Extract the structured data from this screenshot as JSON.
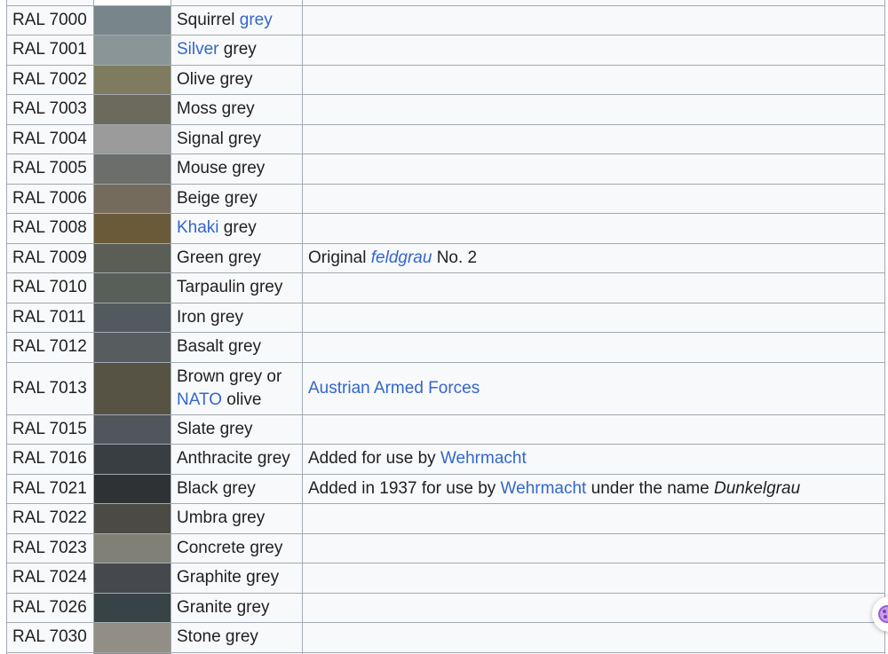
{
  "rows": [
    {
      "code": "",
      "color": "#ffffff",
      "name": [],
      "note": []
    },
    {
      "code": "RAL 7000",
      "color": "#78858b",
      "name": [
        {
          "t": "Squirrel "
        },
        {
          "t": "grey",
          "link": true
        }
      ],
      "note": []
    },
    {
      "code": "RAL 7001",
      "color": "#8a9597",
      "name": [
        {
          "t": "Silver",
          "link": true
        },
        {
          "t": " grey"
        }
      ],
      "note": []
    },
    {
      "code": "RAL 7002",
      "color": "#7e7b5f",
      "name": [
        {
          "t": "Olive grey"
        }
      ],
      "note": []
    },
    {
      "code": "RAL 7003",
      "color": "#6c6a5d",
      "name": [
        {
          "t": "Moss grey"
        }
      ],
      "note": []
    },
    {
      "code": "RAL 7004",
      "color": "#9b9b9b",
      "name": [
        {
          "t": "Signal grey"
        }
      ],
      "note": []
    },
    {
      "code": "RAL 7005",
      "color": "#6c6e6b",
      "name": [
        {
          "t": "Mouse grey"
        }
      ],
      "note": []
    },
    {
      "code": "RAL 7006",
      "color": "#756b5d",
      "name": [
        {
          "t": "Beige grey"
        }
      ],
      "note": []
    },
    {
      "code": "RAL 7008",
      "color": "#6a5a3a",
      "name": [
        {
          "t": "Khaki",
          "link": true
        },
        {
          "t": " grey"
        }
      ],
      "note": []
    },
    {
      "code": "RAL 7009",
      "color": "#5a5e54",
      "name": [
        {
          "t": "Green grey"
        }
      ],
      "note": [
        {
          "t": "Original "
        },
        {
          "t": "feldgrau",
          "link": true,
          "italic": true
        },
        {
          "t": " No. 2"
        }
      ]
    },
    {
      "code": "RAL 7010",
      "color": "#585e58",
      "name": [
        {
          "t": "Tarpaulin grey"
        }
      ],
      "note": []
    },
    {
      "code": "RAL 7011",
      "color": "#535a5f",
      "name": [
        {
          "t": "Iron grey"
        }
      ],
      "note": []
    },
    {
      "code": "RAL 7012",
      "color": "#575d5e",
      "name": [
        {
          "t": "Basalt grey"
        }
      ],
      "note": []
    },
    {
      "code": "RAL 7013",
      "color": "#565344",
      "tall": true,
      "name": [
        {
          "t": "Brown grey or "
        },
        {
          "t": "NATO",
          "link": true
        },
        {
          "t": " olive"
        }
      ],
      "note": [
        {
          "t": "Austrian Armed Forces",
          "link": true
        }
      ]
    },
    {
      "code": "RAL 7015",
      "color": "#51565c",
      "name": [
        {
          "t": "Slate grey"
        }
      ],
      "note": []
    },
    {
      "code": "RAL 7016",
      "color": "#383e42",
      "name": [
        {
          "t": "Anthracite grey"
        }
      ],
      "note": [
        {
          "t": "Added for use by "
        },
        {
          "t": "Wehrmacht",
          "link": true
        }
      ]
    },
    {
      "code": "RAL 7021",
      "color": "#2f3234",
      "name": [
        {
          "t": "Black grey"
        }
      ],
      "note": [
        {
          "t": "Added in 1937 for use by "
        },
        {
          "t": "Wehrmacht",
          "link": true
        },
        {
          "t": " under the name "
        },
        {
          "t": "Dunkelgrau",
          "italic": true
        }
      ]
    },
    {
      "code": "RAL 7022",
      "color": "#4c4a44",
      "name": [
        {
          "t": "Umbra grey"
        }
      ],
      "note": []
    },
    {
      "code": "RAL 7023",
      "color": "#808076",
      "name": [
        {
          "t": "Concrete grey"
        }
      ],
      "note": []
    },
    {
      "code": "RAL 7024",
      "color": "#45494e",
      "name": [
        {
          "t": "Graphite grey"
        }
      ],
      "note": []
    },
    {
      "code": "RAL 7026",
      "color": "#374345",
      "name": [
        {
          "t": "Granite grey"
        }
      ],
      "note": []
    },
    {
      "code": "RAL 7030",
      "color": "#928e85",
      "name": [
        {
          "t": "Stone grey"
        }
      ],
      "note": []
    },
    {
      "code": "",
      "color": "#8b8c87",
      "name": [],
      "note": []
    }
  ],
  "icons": {
    "scroll_widget": "palette-icon"
  }
}
